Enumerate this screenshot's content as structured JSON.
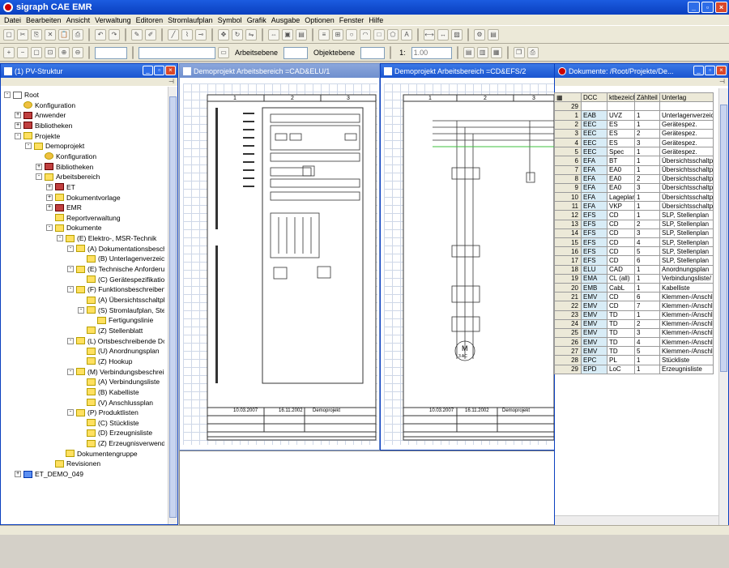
{
  "app": {
    "title": "sigraph CAE EMR"
  },
  "menu": [
    "Datei",
    "Bearbeiten",
    "Ansicht",
    "Verwaltung",
    "Editoren",
    "Stromlaufplan",
    "Symbol",
    "Grafik",
    "Ausgabe",
    "Optionen",
    "Fenster",
    "Hilfe"
  ],
  "toolbar": {
    "ebene_label": "Arbeitsebene",
    "objektebene_label": "Objektebene",
    "scale_prefix": "1:",
    "scale_value": "1.00"
  },
  "tree_panel": {
    "title": "(1) PV-Struktur",
    "items": [
      {
        "label": "Root",
        "depth": 0,
        "exp": "-",
        "icon": "doc"
      },
      {
        "label": "Konfiguration",
        "depth": 1,
        "exp": "",
        "icon": "gear"
      },
      {
        "label": "Anwender",
        "depth": 1,
        "exp": "+",
        "icon": "lib"
      },
      {
        "label": "Bibliotheken",
        "depth": 1,
        "exp": "+",
        "icon": "lib"
      },
      {
        "label": "Projekte",
        "depth": 1,
        "exp": "-",
        "icon": "folder"
      },
      {
        "label": "Demoprojekt",
        "depth": 2,
        "exp": "-",
        "icon": "folder"
      },
      {
        "label": "Konfiguration",
        "depth": 3,
        "exp": "",
        "icon": "gear"
      },
      {
        "label": "Bibliotheken",
        "depth": 3,
        "exp": "+",
        "icon": "lib"
      },
      {
        "label": "Arbeitsbereich",
        "depth": 3,
        "exp": "-",
        "icon": "folder"
      },
      {
        "label": "ET",
        "depth": 4,
        "exp": "+",
        "icon": "lib"
      },
      {
        "label": "Dokumentvorlage",
        "depth": 4,
        "exp": "+",
        "icon": "folder"
      },
      {
        "label": "EMR",
        "depth": 4,
        "exp": "+",
        "icon": "lib"
      },
      {
        "label": "Reportverwaltung",
        "depth": 4,
        "exp": "",
        "icon": "folder"
      },
      {
        "label": "Dokumente",
        "depth": 4,
        "exp": "-",
        "icon": "folder"
      },
      {
        "label": "(E) Elektro-, MSR-Technik",
        "depth": 5,
        "exp": "-",
        "icon": "folder"
      },
      {
        "label": "(A) Dokumentationsbeschreibende",
        "depth": 6,
        "exp": "-",
        "icon": "folder"
      },
      {
        "label": "(B) Unterlagenverzeichnis",
        "depth": 7,
        "exp": "",
        "icon": "folder"
      },
      {
        "label": "(E) Technische Anforderungen und",
        "depth": 6,
        "exp": "-",
        "icon": "folder"
      },
      {
        "label": "(C) Gerätespezifikation",
        "depth": 7,
        "exp": "",
        "icon": "folder"
      },
      {
        "label": "(F) Funktionsbeschreibende Dokun",
        "depth": 6,
        "exp": "-",
        "icon": "folder"
      },
      {
        "label": "(A) Übersichtsschaltplan",
        "depth": 7,
        "exp": "",
        "icon": "folder"
      },
      {
        "label": "(S) Stromlaufplan, Stellenplan",
        "depth": 7,
        "exp": "-",
        "icon": "folder"
      },
      {
        "label": "Fertigungslinie",
        "depth": 8,
        "exp": "",
        "icon": "folder"
      },
      {
        "label": "(Z) Stellenblatt",
        "depth": 7,
        "exp": "",
        "icon": "folder"
      },
      {
        "label": "(L) Ortsbeschreibende Dokumente",
        "depth": 6,
        "exp": "-",
        "icon": "folder"
      },
      {
        "label": "(U) Anordnungsplan",
        "depth": 7,
        "exp": "",
        "icon": "folder"
      },
      {
        "label": "(Z) Hookup",
        "depth": 7,
        "exp": "",
        "icon": "folder"
      },
      {
        "label": "(M) Verbindungsbeschreibende Do",
        "depth": 6,
        "exp": "-",
        "icon": "folder"
      },
      {
        "label": "(A) Verbindungsliste",
        "depth": 7,
        "exp": "",
        "icon": "folder"
      },
      {
        "label": "(B) Kabelliste",
        "depth": 7,
        "exp": "",
        "icon": "folder"
      },
      {
        "label": "(V) Anschlussplan",
        "depth": 7,
        "exp": "",
        "icon": "folder"
      },
      {
        "label": "(P) Produktlisten",
        "depth": 6,
        "exp": "-",
        "icon": "folder"
      },
      {
        "label": "(C) Stückliste",
        "depth": 7,
        "exp": "",
        "icon": "folder"
      },
      {
        "label": "(D) Erzeugnisliste",
        "depth": 7,
        "exp": "",
        "icon": "folder"
      },
      {
        "label": "(Z) Erzeugnisverwendungsplan",
        "depth": 7,
        "exp": "",
        "icon": "folder"
      },
      {
        "label": "Dokumentengruppe",
        "depth": 5,
        "exp": "",
        "icon": "folder"
      },
      {
        "label": "Revisionen",
        "depth": 4,
        "exp": "",
        "icon": "folder"
      },
      {
        "label": "ET_DEMO_049",
        "depth": 1,
        "exp": "+",
        "icon": "blue"
      }
    ]
  },
  "drawing1": {
    "title": "Demoprojekt Arbeitsbereich =CAD&ELU/1",
    "col1": "1",
    "col2": "2",
    "col3": "3",
    "date": "10.03.2007",
    "date2": "16.11.2002",
    "project": "Demoprojekt"
  },
  "drawing2": {
    "title": "Demoprojekt Arbeitsbereich =CD&EFS/2",
    "col1": "1",
    "col2": "2",
    "col3": "3",
    "motor": "M",
    "motor_sub": "3 AC",
    "date": "10.03.2007",
    "date2": "16.11.2002",
    "project": "Demoprojekt"
  },
  "docs": {
    "title": "Dokumente: /Root/Projekte/De...",
    "headers": [
      "DCC",
      "ktbezeichn",
      "Zählteil",
      "Unterlag"
    ],
    "count": "29",
    "rows": [
      [
        "1",
        "EAB",
        "UVZ",
        "1",
        "Unterlagenverzeic"
      ],
      [
        "2",
        "EEC",
        "ES",
        "1",
        "Gerätespez."
      ],
      [
        "3",
        "EEC",
        "ES",
        "2",
        "Gerätespez."
      ],
      [
        "4",
        "EEC",
        "ES",
        "3",
        "Gerätespez."
      ],
      [
        "5",
        "EEC",
        "Spec",
        "1",
        "Gerätespez."
      ],
      [
        "6",
        "EFA",
        "BT",
        "1",
        "Übersichtsschaltp"
      ],
      [
        "7",
        "EFA",
        "EA0",
        "1",
        "Übersichtsschaltp"
      ],
      [
        "8",
        "EFA",
        "EA0",
        "2",
        "Übersichtsschaltp"
      ],
      [
        "9",
        "EFA",
        "EA0",
        "3",
        "Übersichtsschaltp"
      ],
      [
        "10",
        "EFA",
        "Lageplan",
        "1",
        "Übersichtsschaltp"
      ],
      [
        "11",
        "EFA",
        "VKP",
        "1",
        "Übersichtsschaltp"
      ],
      [
        "12",
        "EFS",
        "CD",
        "1",
        "SLP, Stellenplan"
      ],
      [
        "13",
        "EFS",
        "CD",
        "2",
        "SLP, Stellenplan"
      ],
      [
        "14",
        "EFS",
        "CD",
        "3",
        "SLP, Stellenplan"
      ],
      [
        "15",
        "EFS",
        "CD",
        "4",
        "SLP, Stellenplan"
      ],
      [
        "16",
        "EFS",
        "CD",
        "5",
        "SLP, Stellenplan"
      ],
      [
        "17",
        "EFS",
        "CD",
        "6",
        "SLP, Stellenplan"
      ],
      [
        "18",
        "ELU",
        "CAD",
        "1",
        "Anordnungsplan"
      ],
      [
        "19",
        "EMA",
        "CL (all)",
        "1",
        "Verbindungsliste/"
      ],
      [
        "20",
        "EMB",
        "CabL",
        "1",
        "Kabelliste"
      ],
      [
        "21",
        "EMV",
        "CD",
        "6",
        "Klemmen-/Anschl"
      ],
      [
        "22",
        "EMV",
        "CD",
        "7",
        "Klemmen-/Anschl"
      ],
      [
        "23",
        "EMV",
        "TD",
        "1",
        "Klemmen-/Anschl"
      ],
      [
        "24",
        "EMV",
        "TD",
        "2",
        "Klemmen-/Anschl"
      ],
      [
        "25",
        "EMV",
        "TD",
        "3",
        "Klemmen-/Anschl"
      ],
      [
        "26",
        "EMV",
        "TD",
        "4",
        "Klemmen-/Anschl"
      ],
      [
        "27",
        "EMV",
        "TD",
        "5",
        "Klemmen-/Anschl"
      ],
      [
        "28",
        "EPC",
        "PL",
        "1",
        "Stückliste"
      ],
      [
        "29",
        "EPD",
        "LoC",
        "1",
        "Erzeugnisliste"
      ]
    ]
  }
}
